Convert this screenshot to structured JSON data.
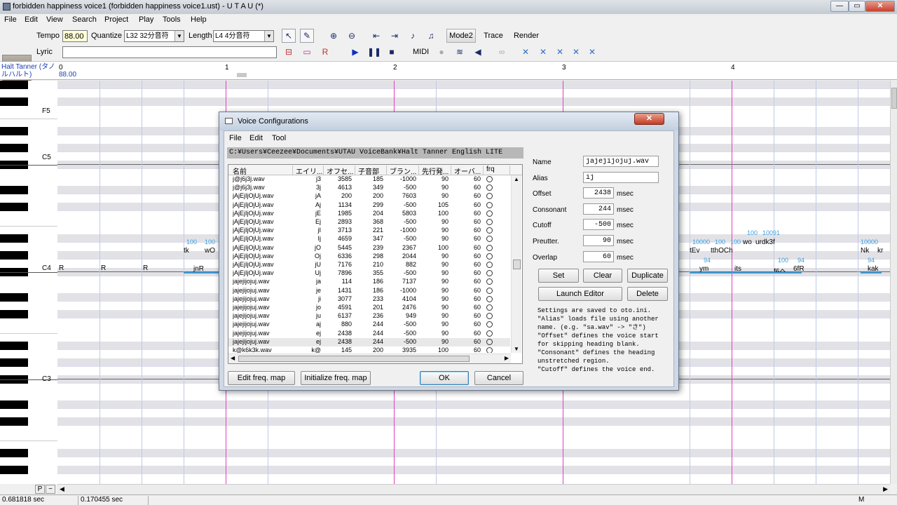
{
  "window": {
    "title": "forbidden happiness voice1 (forbidden happiness voice1.ust) - U T A U (*)",
    "minimize": "—",
    "maximize": "▭",
    "close": "✕"
  },
  "menubar": [
    "File",
    "Edit",
    "View",
    "Search",
    "Project",
    "Play",
    "Tools",
    "Help"
  ],
  "toolbar": {
    "tempo_label": "Tempo",
    "tempo_value": "88.00",
    "quantize_label": "Quantize",
    "quantize_value": "L32 32分音符",
    "length_label": "Length",
    "length_value": "L4  4分音符",
    "lyric_label": "Lyric",
    "lyric_value": "",
    "mode2": "Mode2",
    "trace": "Trace",
    "render": "Render",
    "midi": "MIDI"
  },
  "track": {
    "singer": "Halt Tanner (タノルハルト)",
    "tempo_marker": "88.00",
    "ruler": [
      "0",
      "1",
      "2",
      "3",
      "4"
    ]
  },
  "keyboard_labels": [
    "F5",
    "C5",
    "C4",
    "C3"
  ],
  "notes": {
    "rests": [
      "R",
      "R",
      "R"
    ],
    "lyrics": [
      "tk",
      "wO",
      "jnR",
      "tEv",
      "tthOCh",
      "wo",
      "urdk3f",
      "ym",
      "its",
      "f6へ",
      "6fR",
      "Nk",
      "kr",
      "kak"
    ],
    "env_values": [
      "100",
      "100",
      "10000",
      "100",
      "100",
      "100",
      "100",
      "10091",
      "94",
      "100",
      "94",
      "100",
      "10000",
      "94"
    ]
  },
  "status": {
    "time1": "0.681818 sec",
    "time2": "0.170455 sec",
    "mode": "M"
  },
  "dialog": {
    "title": "Voice Configurations",
    "menu": [
      "File",
      "Edit",
      "Tool"
    ],
    "path": "C:¥Users¥Ceezee¥Documents¥UTAU VoiceBank¥Halt Tanner English LITE",
    "columns": [
      "名前",
      "エイリ...",
      "オフセ...",
      "子音部",
      "ブラン...",
      "先行発...",
      "オーバ...",
      "frq"
    ],
    "rows": [
      [
        "j@j6j3j.wav",
        "j3",
        "3585",
        "185",
        "-1000",
        "90",
        "60"
      ],
      [
        "j@j6j3j.wav",
        "3j",
        "4613",
        "349",
        "-500",
        "90",
        "60"
      ],
      [
        "jAjEjIjOjUj.wav",
        "jA",
        "200",
        "200",
        "7603",
        "90",
        "60"
      ],
      [
        "jAjEjIjOjUj.wav",
        "Aj",
        "1134",
        "299",
        "-500",
        "105",
        "60"
      ],
      [
        "jAjEjIjOjUj.wav",
        "jE",
        "1985",
        "204",
        "5803",
        "100",
        "60"
      ],
      [
        "jAjEjIjOjUj.wav",
        "Ej",
        "2893",
        "368",
        "-500",
        "90",
        "60"
      ],
      [
        "jAjEjIjOjUj.wav",
        "jI",
        "3713",
        "221",
        "-1000",
        "90",
        "60"
      ],
      [
        "jAjEjIjOjUj.wav",
        "Ij",
        "4659",
        "347",
        "-500",
        "90",
        "60"
      ],
      [
        "jAjEjIjOjUj.wav",
        "jO",
        "5445",
        "239",
        "2367",
        "100",
        "60"
      ],
      [
        "jAjEjIjOjUj.wav",
        "Oj",
        "6336",
        "298",
        "2044",
        "90",
        "60"
      ],
      [
        "jAjEjIjOjUj.wav",
        "jU",
        "7176",
        "210",
        "882",
        "90",
        "60"
      ],
      [
        "jAjEjIjOjUj.wav",
        "Uj",
        "7896",
        "355",
        "-500",
        "90",
        "60"
      ],
      [
        "jajejijojuj.wav",
        "ja",
        "114",
        "186",
        "7137",
        "90",
        "60"
      ],
      [
        "jajejijojuj.wav",
        "je",
        "1431",
        "186",
        "-1000",
        "90",
        "60"
      ],
      [
        "jajejijojuj.wav",
        "ji",
        "3077",
        "233",
        "4104",
        "90",
        "60"
      ],
      [
        "jajejijojuj.wav",
        "jo",
        "4591",
        "201",
        "2476",
        "90",
        "60"
      ],
      [
        "jajejijojuj.wav",
        "ju",
        "6137",
        "236",
        "949",
        "90",
        "60"
      ],
      [
        "jajejijojuj.wav",
        "aj",
        "880",
        "244",
        "-500",
        "90",
        "60"
      ],
      [
        "jajejijojuj.wav",
        "ej",
        "2438",
        "244",
        "-500",
        "90",
        "60"
      ],
      [
        "jajejijojuj.wav",
        "ej",
        "2438",
        "244",
        "-500",
        "90",
        "60"
      ],
      [
        "k@k6k3k.wav",
        "k@",
        "145",
        "200",
        "3935",
        "100",
        "60"
      ]
    ],
    "selected_row": 19,
    "fields": {
      "name_label": "Name",
      "name_value": "jajejijojuj.wav",
      "alias_label": "Alias",
      "alias_value": "ij",
      "offset_label": "Offset",
      "offset_value": "2438",
      "consonant_label": "Consonant",
      "consonant_value": "244",
      "cutoff_label": "Cutoff",
      "cutoff_value": "-500",
      "preutter_label": "Preutter.",
      "preutter_value": "90",
      "overlap_label": "Overlap",
      "overlap_value": "60",
      "unit": "msec"
    },
    "buttons": {
      "set": "Set",
      "clear": "Clear",
      "duplicate": "Duplicate",
      "launch_editor": "Launch Editor",
      "delete": "Delete",
      "edit_freq": "Edit freq. map",
      "init_freq": "Initialize freq. map",
      "ok": "OK",
      "cancel": "Cancel"
    },
    "help": "Settings are saved to oto.ini.\n\"Alias\" loads file using another name. (e.g. \"sa.wav\" -> \"さ\")\n\"Offset\" defines the voice start for skipping heading blank.\n\"Consonant\" defines the heading unstretched region.\n\"Cutoff\" defines the voice end."
  }
}
